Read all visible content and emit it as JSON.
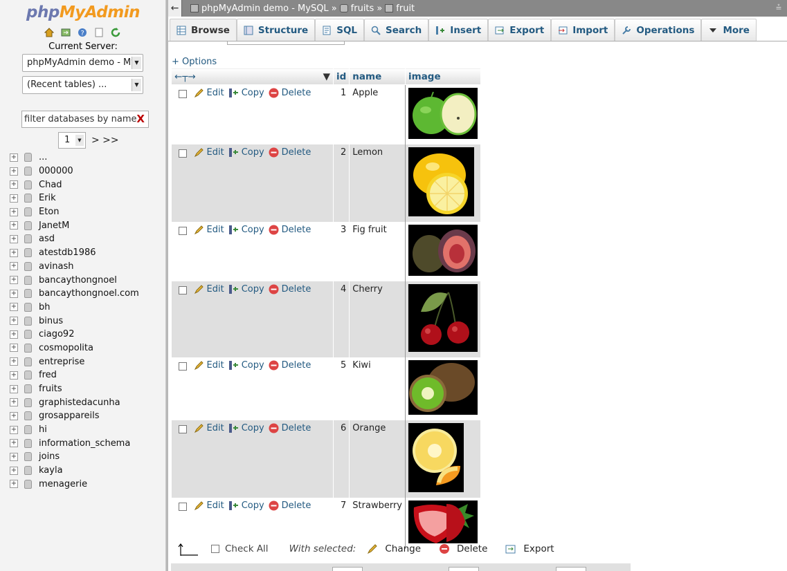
{
  "sidebar": {
    "logo_php": "php",
    "logo_ma": "MyAdmin",
    "current_server_label": "Current Server:",
    "server_select": "phpMyAdmin demo - My",
    "recent_select": "(Recent tables) ...",
    "filter_placeholder": "filter databases by name",
    "filter_clear": "X",
    "page_select": "1",
    "page_next": "> >>",
    "databases": [
      "...",
      "000000",
      "Chad",
      "Erik",
      "Eton",
      "JanetM",
      "asd",
      "atestdb1986",
      "avinash",
      "bancaythongnoel",
      "bancaythongnoel.com",
      "bh",
      "binus",
      "ciago92",
      "cosmopolita",
      "entreprise",
      "fred",
      "fruits",
      "graphistedacunha",
      "grosappareils",
      "hi",
      "information_schema",
      "joins",
      "kayla",
      "menagerie"
    ]
  },
  "topbar": {
    "back": "←",
    "server": "phpMyAdmin demo - MySQL",
    "sep": "»",
    "database": "fruits",
    "table": "fruit"
  },
  "tabs": [
    {
      "label": "Browse",
      "icon": "browse-icon"
    },
    {
      "label": "Structure",
      "icon": "structure-icon"
    },
    {
      "label": "SQL",
      "icon": "sql-icon"
    },
    {
      "label": "Search",
      "icon": "search-icon"
    },
    {
      "label": "Insert",
      "icon": "insert-icon"
    },
    {
      "label": "Export",
      "icon": "export-icon"
    },
    {
      "label": "Import",
      "icon": "import-icon"
    },
    {
      "label": "Operations",
      "icon": "wrench-icon"
    },
    {
      "label": "More",
      "icon": "chevron-down-icon"
    }
  ],
  "options_link": "+ Options",
  "table": {
    "columns": [
      "id",
      "name",
      "image"
    ],
    "action_labels": {
      "edit": "Edit",
      "copy": "Copy",
      "delete": "Delete"
    },
    "rows": [
      {
        "id": "1",
        "name": "Apple"
      },
      {
        "id": "2",
        "name": "Lemon"
      },
      {
        "id": "3",
        "name": "Fig fruit"
      },
      {
        "id": "4",
        "name": "Cherry"
      },
      {
        "id": "5",
        "name": "Kiwi"
      },
      {
        "id": "6",
        "name": "Orange"
      },
      {
        "id": "7",
        "name": "Strawberry"
      }
    ]
  },
  "footer": {
    "check_all": "Check All",
    "with_selected": "With selected:",
    "change": "Change",
    "delete": "Delete",
    "export": "Export"
  },
  "colors": {
    "link": "#235a81",
    "logo_php": "#6c78af",
    "logo_ma": "#f29a1f"
  }
}
